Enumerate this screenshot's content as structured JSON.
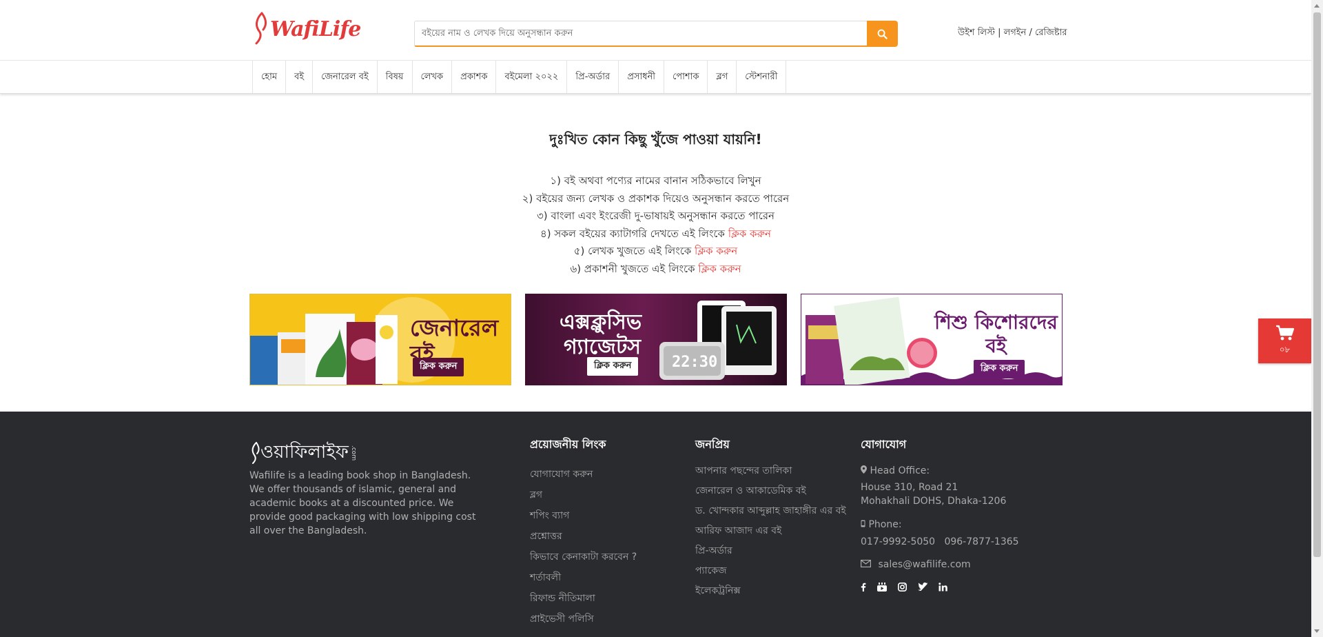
{
  "header": {
    "logo_text": "WafiLife",
    "search_placeholder": "বইয়ের নাম ও লেখক দিয়ে অনুসন্ধান করুন",
    "account": {
      "wishlist": "উইশ লিস্ট",
      "login": "লগইন",
      "register": "রেজিষ্টার"
    }
  },
  "nav": {
    "items": [
      "হোম",
      "বই",
      "জেনারেল বই",
      "বিষয়",
      "লেখক",
      "প্রকাশক",
      "বইমেলা ২০২২",
      "প্রি-অর্ডার",
      "প্রসাধনী",
      "পোশাক",
      "ব্লগ",
      "স্টেশনারী"
    ]
  },
  "main": {
    "not_found": "দুঃখিত কোন কিছু খুঁজে পাওয়া যায়নি!",
    "tips": {
      "t1": "১) বই অথবা পণ্যের নামের বানান সঠিকভাবে লিখুন",
      "t2": "২) বইয়ের জন্য লেখক ও প্রকাশক দিয়েও অনুসন্ধান করতে পারেন",
      "t3": "৩) বাংলা এবং ইংরেজী দু-ভাষায়ই অনুসন্ধান করতে পারেন",
      "t4": "৪) সকল বইয়ের ক্যাটাগরি দেখতে এই লিংকে",
      "t5": "৫) লেখক খুজতে এই লিংকে",
      "t6": "৬) প্রকাশনী খুজতে এই লিংকে",
      "link": "ক্লিক করুন"
    },
    "banners": {
      "b1_title": "জেনারেল বই",
      "b1_cta": "ক্লিক করুন",
      "b2_title_1": "এক্সক্লুসিভ",
      "b2_title_2": "গ্যাজেটস",
      "b2_cta": "ক্লিক করুন",
      "b2_clock": "22:30",
      "b3_title_1": "শিশু কিশোরদের",
      "b3_title_2": "বই",
      "b3_cta": "ক্লিক করুন"
    }
  },
  "cart": {
    "count": "০৮"
  },
  "footer": {
    "logo_text": "ওয়াফিলাইফ",
    "logo_suffix": ".com",
    "about": "Wafilife is a leading book shop in Bangladesh. We offer thousands of islamic, general and academic books at a discounted price. We provide good packaging with low shipping cost all over the Bangladesh.",
    "links_heading": "প্রয়োজনীয় লিংক",
    "links": [
      "যোগাযোগ করুন",
      "ব্লগ",
      "শপিং ব্যাগ",
      "প্রশ্নোত্তর",
      "কিভাবে কেনাকাটা করবেন ?",
      "শর্তাবলী",
      "রিফান্ড নীতিমালা",
      "প্রাইভেসী পলিসি"
    ],
    "popular_heading": "জনপ্রিয়",
    "popular": [
      "আপনার পছন্দের তালিকা",
      "জেনারেল ও আকাডেমিক বই",
      "ড. খোন্দকার আব্দুল্লাহ জাহাঙ্গীর এর বই",
      "আরিফ আজাদ এর বই",
      "প্রি-অর্ডার",
      "প্যাকেজ",
      "ইলেকট্রনিক্স"
    ],
    "contact_heading": "যোগাযোগ",
    "contact": {
      "office_label": "Head Office:",
      "address_1": "House 310, Road 21",
      "address_2": "Mohakhali DOHS, Dhaka-1206",
      "phone_label": "Phone:",
      "phone_1": "017-9992-5050",
      "phone_2": "096-7877-1365",
      "email": "sales@wafilife.com"
    },
    "social": [
      "facebook-icon",
      "youtube-icon",
      "instagram-icon",
      "twitter-icon",
      "linkedin-icon"
    ]
  },
  "colors": {
    "accent_orange": "#f7941d",
    "link_red": "#e53935",
    "brand_red": "#e23b3b",
    "footer_bg": "#2a2b2f"
  }
}
